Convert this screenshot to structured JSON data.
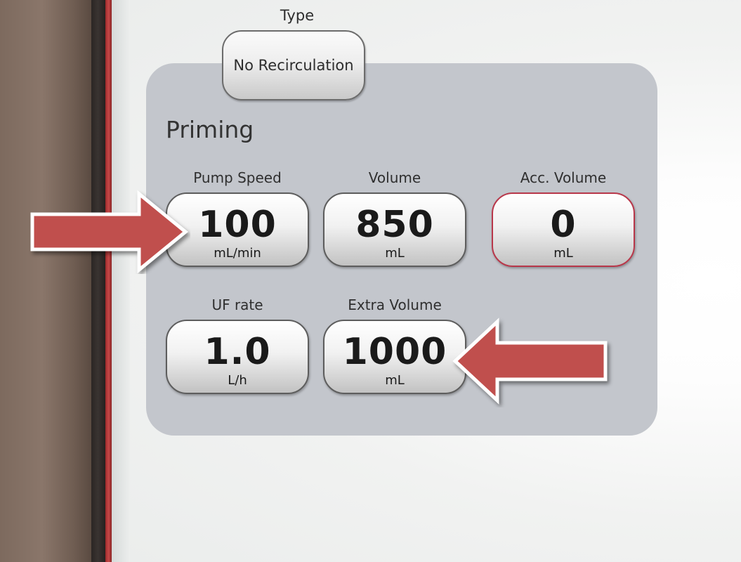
{
  "type": {
    "label": "Type",
    "value": "No Recirculation"
  },
  "priming": {
    "title": "Priming",
    "fields": [
      {
        "id": "pump_speed",
        "label": "Pump Speed",
        "value": "100",
        "unit": "mL/min"
      },
      {
        "id": "volume",
        "label": "Volume",
        "value": "850",
        "unit": "mL"
      },
      {
        "id": "acc_volume",
        "label": "Acc. Volume",
        "value": "0",
        "unit": "mL"
      },
      {
        "id": "uf_rate",
        "label": "UF rate",
        "value": "1.0",
        "unit": "L/h"
      },
      {
        "id": "extra_volume",
        "label": "Extra Volume",
        "value": "1000",
        "unit": "mL"
      }
    ]
  },
  "colors": {
    "panel": "#c3c6cc",
    "arrow": "#c0504d",
    "acc_border": "#b8374a"
  },
  "icons": [
    "arrow-right-icon",
    "arrow-left-icon"
  ]
}
